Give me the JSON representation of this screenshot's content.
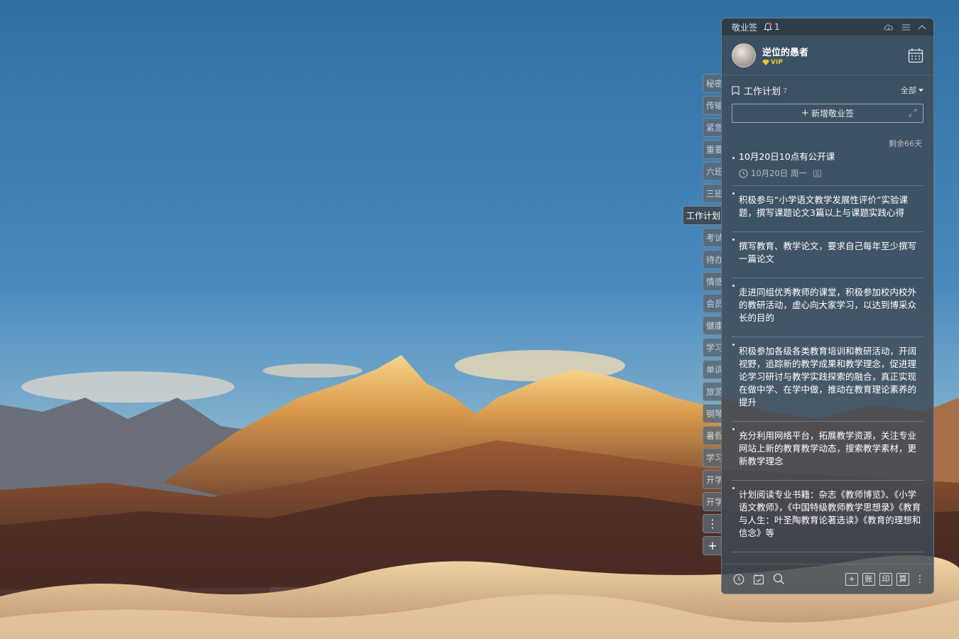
{
  "colors": {
    "panel_bg": "#3e4a56",
    "accent_vip": "#f2c532",
    "reminder_dot": "#e54545"
  },
  "side_tabs": [
    {
      "label": "秘密",
      "active": false
    },
    {
      "label": "传输",
      "active": false
    },
    {
      "label": "紧急",
      "active": false
    },
    {
      "label": "重要",
      "active": false
    },
    {
      "label": "六班",
      "active": false
    },
    {
      "label": "三班",
      "active": false
    },
    {
      "label": "工作计划",
      "active": true
    },
    {
      "label": "考试",
      "active": false
    },
    {
      "label": "待办",
      "active": false
    },
    {
      "label": "情感",
      "active": false,
      "flag": true
    },
    {
      "label": "会员",
      "active": false
    },
    {
      "label": "健康",
      "active": false
    },
    {
      "label": "学习",
      "active": false
    },
    {
      "label": "单词",
      "active": false
    },
    {
      "label": "旅游",
      "active": false
    },
    {
      "label": "钢琴",
      "active": false
    },
    {
      "label": "暑假",
      "active": false
    },
    {
      "label": "学习",
      "active": false
    },
    {
      "label": "开学",
      "active": false
    },
    {
      "label": "开学",
      "active": false
    }
  ],
  "side_tools": {
    "more": "⋮",
    "add": "+"
  },
  "titlebar": {
    "app_title": "敬业签",
    "notification_count": "1",
    "icons": [
      "cloud-sync-icon",
      "menu-icon",
      "collapse-icon"
    ]
  },
  "user": {
    "name": "逆位的愚者",
    "vip_label": "VIP"
  },
  "list": {
    "title": "工作计划",
    "count": "7",
    "filter_label": "全部"
  },
  "add_note": {
    "label": "新增敬业签"
  },
  "days_left": "剩余66天",
  "notes": [
    {
      "text": "10月20日10点有公开课",
      "date": "10月20日 周一",
      "has_reminder": true
    },
    {
      "text": "积极参与“小学语文教学发展性评价”实验课题，撰写课题论文3篇以上与课题实践心得"
    },
    {
      "text": "撰写教育、教学论文，要求自己每年至少撰写一篇论文"
    },
    {
      "text": "走进同组优秀教师的课堂，积极参加校内校外的教研活动，虚心向大家学习，以达到博采众长的目的"
    },
    {
      "text": "积极参加各级各类教育培训和教研活动，开阔视野，追踪新的教学成果和教学理念，促进理论学习研讨与教学实践探索的融合，真正实现在做中学、在学中做，推动在教育理论素养的提升"
    },
    {
      "text": "充分利用网络平台，拓展教学资源，关注专业网站上新的教育教学动态，搜索教学素材，更新教学理念"
    },
    {
      "text": "计划阅读专业书籍：杂志《教师博览》、《小学语文教师》，《中国特级教师教学思想录》《教育与人生：叶圣陶教育论著选读》《教育的理想和信念》等"
    }
  ],
  "bottom_tools": {
    "left_icons": [
      "clock-icon",
      "checklist-icon",
      "search-icon"
    ],
    "right_buttons": [
      "+",
      "账",
      "印",
      "算"
    ],
    "more": "⋮"
  }
}
